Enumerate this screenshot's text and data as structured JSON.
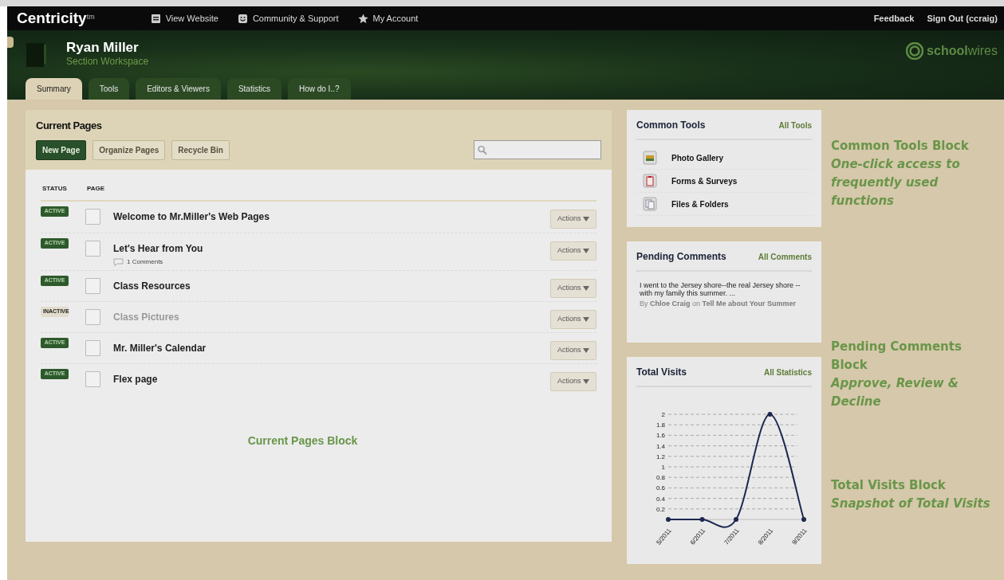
{
  "topbar": {
    "brand": "Centricity",
    "brand_mark": "tm",
    "links": [
      {
        "kind": "website",
        "label": "View Website"
      },
      {
        "kind": "community",
        "label": "Community & Support"
      },
      {
        "kind": "account",
        "label": "My Account"
      }
    ],
    "right_links": [
      "Feedback",
      "Sign Out (ccraig)"
    ]
  },
  "header": {
    "name": "Ryan Miller",
    "subtitle": "Section Workspace",
    "logo_text": "school",
    "logo_text_2": "wires"
  },
  "tabs": [
    {
      "label": "Summary",
      "selected": true
    },
    {
      "label": "Tools",
      "selected": false
    },
    {
      "label": "Editors & Viewers",
      "selected": false
    },
    {
      "label": "Statistics",
      "selected": false
    },
    {
      "label": "How do I..?",
      "selected": false
    }
  ],
  "current_pages": {
    "title": "Current Pages",
    "buttons": [
      {
        "label": "New Page",
        "kind": "primary"
      },
      {
        "label": "Organize Pages",
        "kind": "secondary"
      },
      {
        "label": "Recycle Bin",
        "kind": "secondary"
      }
    ],
    "columns": [
      "STATUS",
      "PAGE"
    ],
    "rows": [
      {
        "status": "ACTIVE",
        "active": true,
        "checked": false,
        "title": "Welcome to Mr.Miller's Web Pages",
        "action": "Actions"
      },
      {
        "status": "ACTIVE",
        "active": true,
        "checked": false,
        "title": "Let's Hear from You",
        "comments": "1 Comments",
        "action": "Actions"
      },
      {
        "status": "ACTIVE",
        "active": true,
        "checked": false,
        "title": "Class Resources",
        "action": "Actions"
      },
      {
        "status": "INACTIVE",
        "active": false,
        "checked": false,
        "title": "Class Pictures",
        "action": "Actions"
      },
      {
        "status": "ACTIVE",
        "active": true,
        "checked": false,
        "title": "Mr. Miller's Calendar",
        "action": "Actions"
      },
      {
        "status": "ACTIVE",
        "active": true,
        "checked": false,
        "title": "Flex page",
        "action": "Actions"
      }
    ],
    "caption": "Current Pages Block"
  },
  "common_tools": {
    "title": "Common Tools",
    "link": "All Tools",
    "items": [
      {
        "kind": "photo",
        "label": "Photo Gallery"
      },
      {
        "kind": "form",
        "label": "Forms & Surveys"
      },
      {
        "kind": "files",
        "label": "Files & Folders"
      }
    ]
  },
  "pending_comments": {
    "title": "Pending Comments",
    "link": "All Comments",
    "comment": "I went to the Jersey shore--the real Jersey shore --with my family this summer. ...",
    "byline": "By **Chloe Craig** on **Tell Me about Your Summer**"
  },
  "total_visits": {
    "title": "Total Visits",
    "link": "All Statistics",
    "chart_data": {
      "type": "line",
      "categories": [
        "5/2011",
        "6/2011",
        "7/2011",
        "8/2011",
        "9/2011"
      ],
      "series": [
        {
          "color": "#1c2850",
          "marker": true,
          "values": [
            0,
            0,
            0,
            2,
            0
          ]
        }
      ],
      "grid": true,
      "ylim": [
        0,
        2
      ],
      "yticks": [
        0.2,
        0.4,
        0.6,
        0.8,
        1,
        1.2,
        1.4,
        1.6,
        1.8,
        2
      ]
    }
  },
  "annotations": [
    {
      "title": "Common Tools Block",
      "text": "One-click access to frequently used functions"
    },
    {
      "title": "Pending Comments Block",
      "text": "Approve, Review & Decline"
    },
    {
      "title": "Total Visits Block",
      "text": "Snapshot of Total Visits"
    }
  ]
}
